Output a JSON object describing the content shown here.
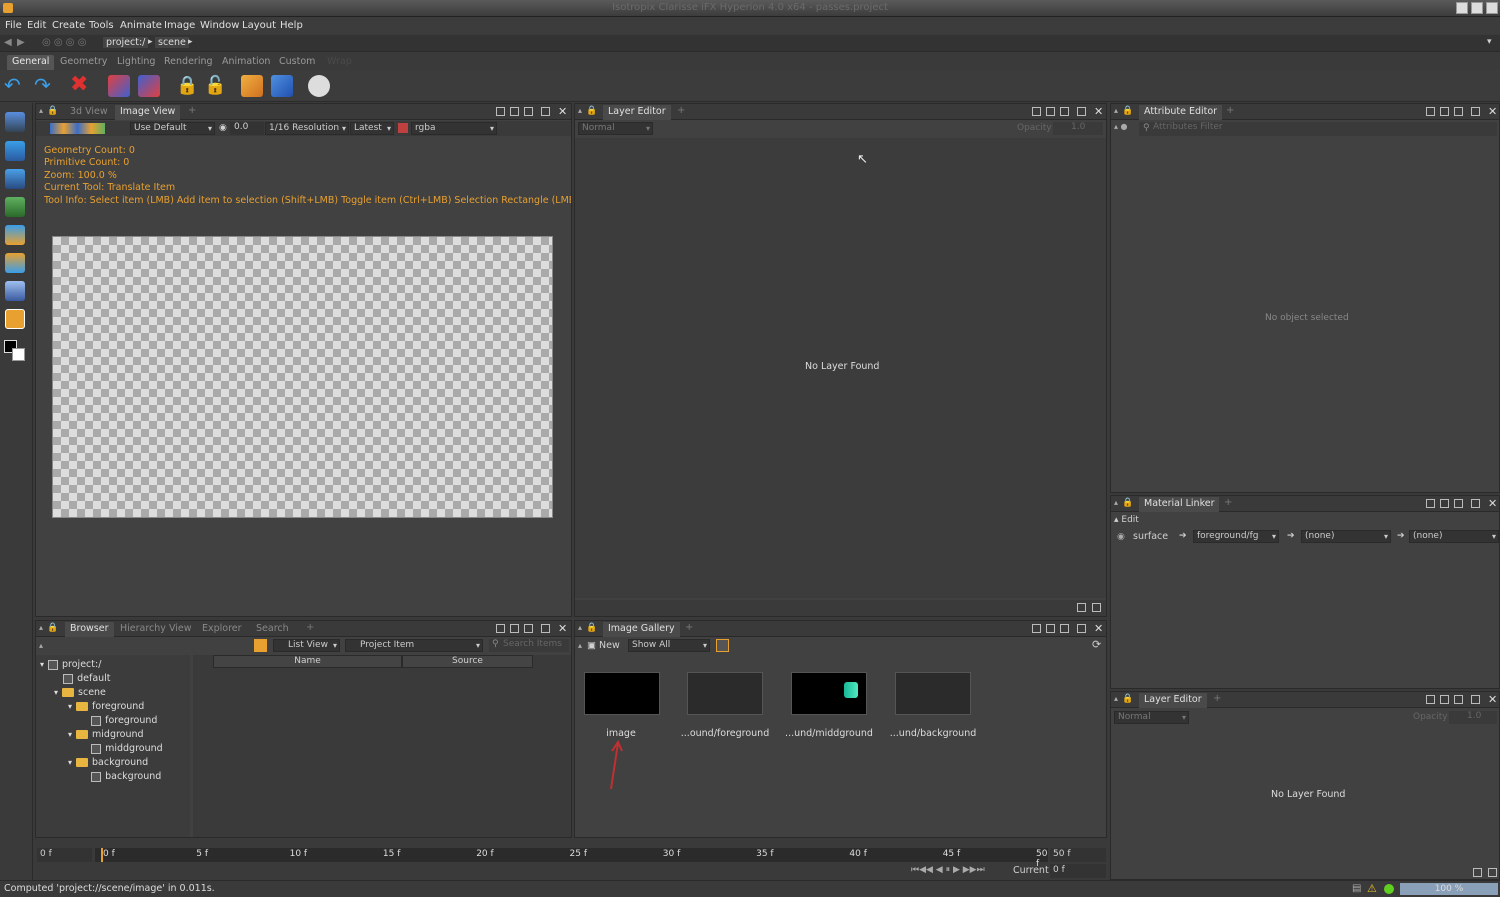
{
  "window": {
    "title": "Isotropix Clarisse iFX Hyperion 4.0 x64 - passes.project"
  },
  "menu": [
    "File",
    "Edit",
    "Create",
    "Tools",
    "Animate",
    "Image",
    "Window",
    "Layout",
    "Help"
  ],
  "path": {
    "root": "project:/",
    "child": "scene"
  },
  "shelf_tabs": [
    "General",
    "Geometry",
    "Lighting",
    "Rendering",
    "Animation",
    "Custom",
    "Wrap"
  ],
  "image_view": {
    "tabs": [
      "3d View",
      "Image View"
    ],
    "display": "Use Default",
    "exposure": "0.0",
    "resolution": "1/16 Resolution",
    "layer": "Latest",
    "channel": "rgba",
    "info": {
      "geometry": "Geometry Count: 0",
      "primitive": "Primitive Count: 0",
      "zoom": "Zoom: 100.0 %",
      "tool": "Current Tool: Translate Item",
      "tool_info": "Tool Info: Select item (LMB)  Add item to selection (Shift+LMB)  Toggle item (Ctrl+LMB)  Selection Rectangle (LMB-Drag"
    }
  },
  "layer_editor": {
    "title": "Layer Editor",
    "blend": "Normal",
    "opacity_label": "Opacity",
    "opacity": "1.0",
    "empty": "No Layer Found"
  },
  "attribute_editor": {
    "title": "Attribute Editor",
    "filter_placeholder": "Attributes Filter",
    "empty": "No object selected"
  },
  "material_linker": {
    "title": "Material Linker",
    "edit": "Edit",
    "surface": "surface",
    "material": "foreground/fg",
    "none1": "(none)",
    "none2": "(none)"
  },
  "layer_editor2": {
    "title": "Layer Editor",
    "blend": "Normal",
    "opacity_label": "Opacity",
    "opacity": "1.0",
    "empty": "No Layer Found"
  },
  "browser": {
    "tabs": [
      "Browser",
      "Hierarchy View",
      "Explorer",
      "Search"
    ],
    "view": "List View",
    "filter": "Project Item",
    "search_placeholder": "Search Items",
    "columns": [
      "Name",
      "Source"
    ],
    "tree": [
      {
        "label": "project:/",
        "depth": 0,
        "kind": "root"
      },
      {
        "label": "default",
        "depth": 1,
        "kind": "ctx"
      },
      {
        "label": "scene",
        "depth": 1,
        "kind": "folder"
      },
      {
        "label": "foreground",
        "depth": 2,
        "kind": "folder"
      },
      {
        "label": "foreground",
        "depth": 3,
        "kind": "node"
      },
      {
        "label": "midground",
        "depth": 2,
        "kind": "folder"
      },
      {
        "label": "middground",
        "depth": 3,
        "kind": "node"
      },
      {
        "label": "background",
        "depth": 2,
        "kind": "folder"
      },
      {
        "label": "background",
        "depth": 3,
        "kind": "node"
      }
    ]
  },
  "gallery": {
    "title": "Image Gallery",
    "new": "New",
    "show": "Show All",
    "items": [
      "image",
      "...ound/foreground",
      "...und/middground",
      "...und/background"
    ]
  },
  "timeline": {
    "start": "0 f",
    "end": "50 f",
    "ticks": [
      "0 f",
      "5 f",
      "10 f",
      "15 f",
      "20 f",
      "25 f",
      "30 f",
      "35 f",
      "40 f",
      "45 f",
      "50 f"
    ],
    "current_label": "Current",
    "current": "0 f"
  },
  "status": {
    "message": "Computed 'project://scene/image' in 0.011s.",
    "progress": "100 %"
  },
  "colors": {
    "accent": "#e8a030",
    "bg": "#414141"
  }
}
